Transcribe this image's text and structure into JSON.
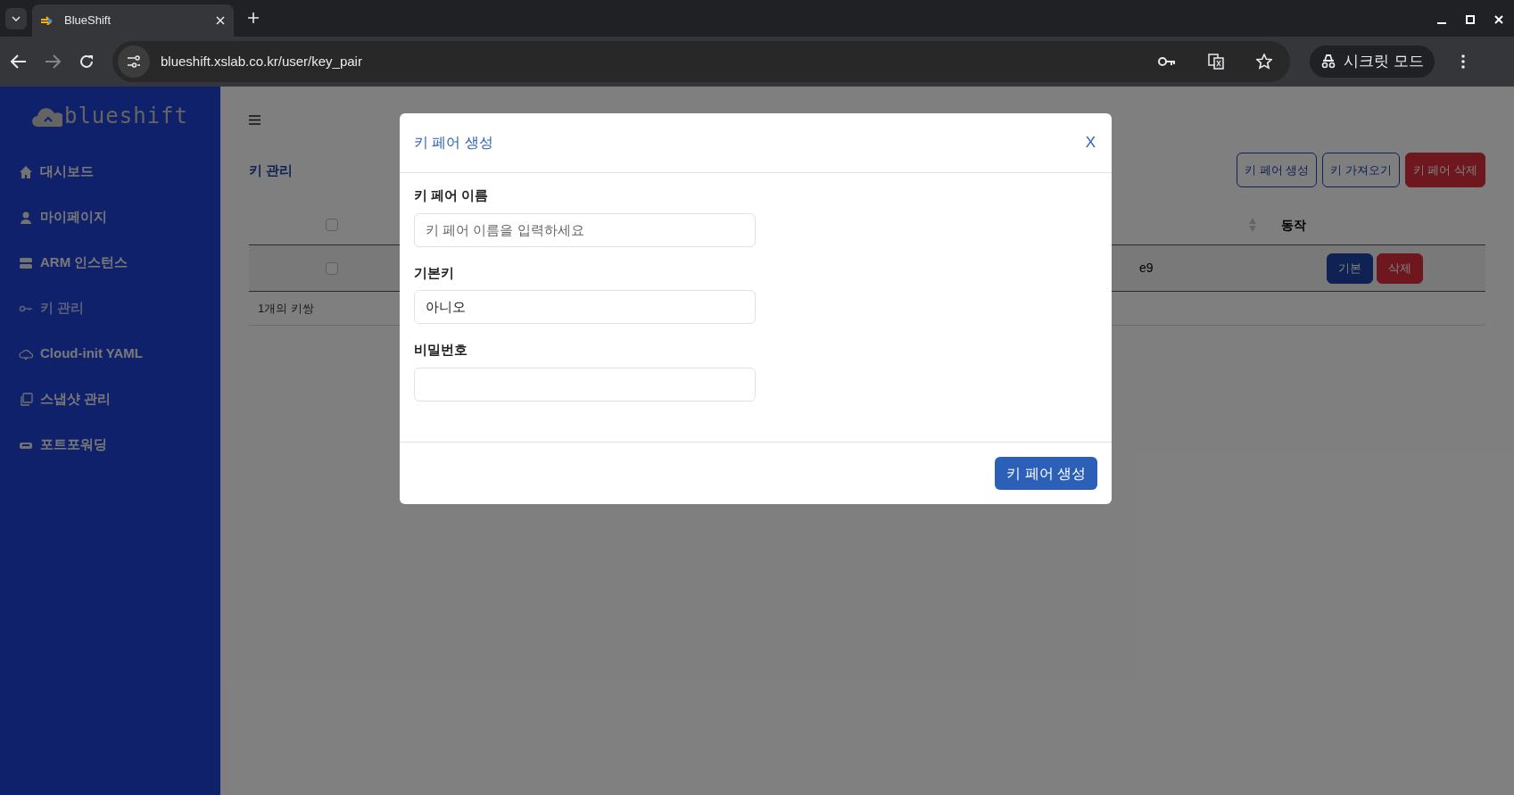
{
  "browser": {
    "tab_title": "BlueShift",
    "url": "blueshift.xslab.co.kr/user/key_pair",
    "incognito_label": "시크릿 모드"
  },
  "sidebar": {
    "logo": "blueshift",
    "items": [
      {
        "label": "대시보드",
        "selected": false
      },
      {
        "label": "마이페이지",
        "selected": false
      },
      {
        "label": "ARM 인스턴스",
        "selected": false
      },
      {
        "label": "키 관리",
        "selected": true
      },
      {
        "label": "Cloud-init YAML",
        "selected": false
      },
      {
        "label": "스냅샷 관리",
        "selected": false
      },
      {
        "label": "포트포워딩",
        "selected": false
      }
    ]
  },
  "page": {
    "title": "키 관리",
    "buttons": [
      {
        "label": "키 페어 생성",
        "kind": "outline"
      },
      {
        "label": "키 가져오기",
        "kind": "outline"
      },
      {
        "label": "키 페어 삭제",
        "kind": "danger"
      }
    ],
    "table": {
      "select_all_checked": false,
      "column_action": "동작",
      "rows": [
        {
          "checked": false,
          "cell": "e9",
          "actions": [
            {
              "label": "기본",
              "kind": "primary"
            },
            {
              "label": "삭제",
              "kind": "danger"
            }
          ]
        }
      ],
      "footer": "1개의 키쌍"
    }
  },
  "modal": {
    "title": "키 페어 생성",
    "close": "X",
    "fields": [
      {
        "label": "키 페어 이름",
        "placeholder": "키 페어 이름을 입력하세요"
      },
      {
        "label": "기본키",
        "value": "아니오"
      },
      {
        "label": "비밀번호"
      }
    ],
    "submit": "키 페어 생성"
  }
}
